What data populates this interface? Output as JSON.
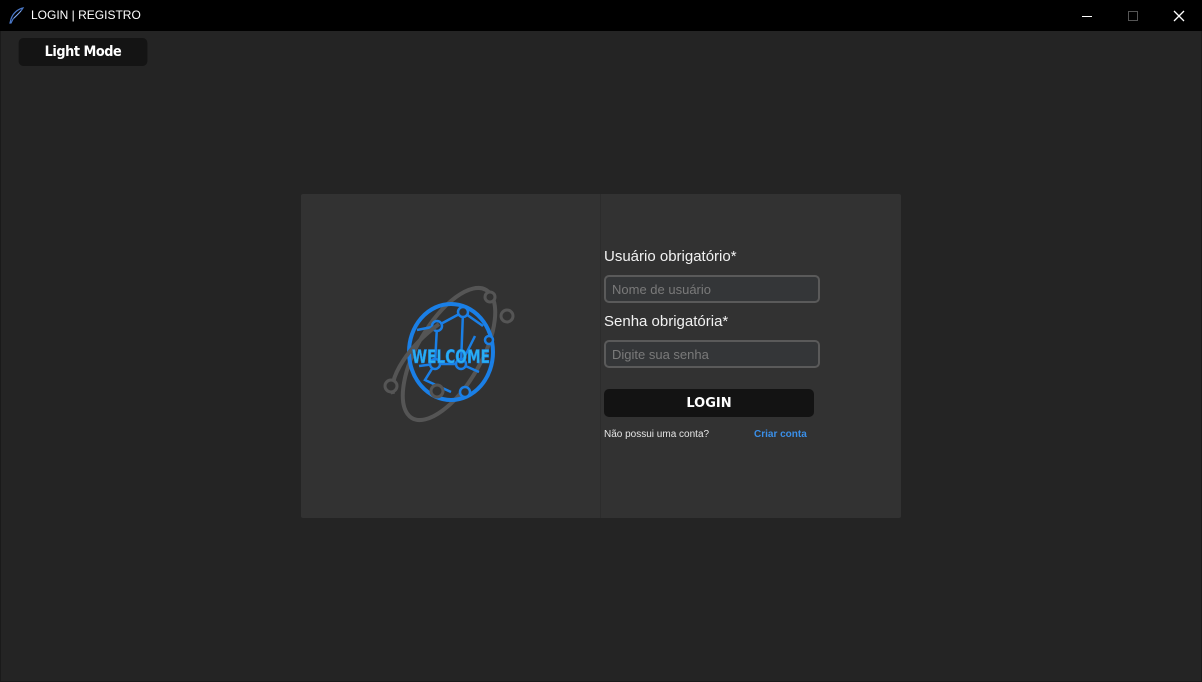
{
  "window": {
    "title": "LOGIN | REGISTRO",
    "icon": "feather-pen-icon"
  },
  "toolbar": {
    "mode_button": "Light Mode"
  },
  "logo": {
    "text": "WELCOME",
    "icon": "globe-network-orbit-icon",
    "colors": {
      "globe": "#1a7fe6",
      "text": "#2ab0f0",
      "orbit": "#555555"
    }
  },
  "form": {
    "username_label": "Usuário obrigatório*",
    "username_placeholder": "Nome de usuário",
    "username_value": "",
    "password_label": "Senha obrigatória*",
    "password_placeholder": "Digite sua senha",
    "password_value": "",
    "login_button": "LOGIN",
    "no_account_text": "Não possui uma conta?",
    "create_account_link": "Criar conta"
  },
  "colors": {
    "background": "#242424",
    "card": "#323232",
    "titlebar": "#000000",
    "link": "#3a8fe8"
  }
}
